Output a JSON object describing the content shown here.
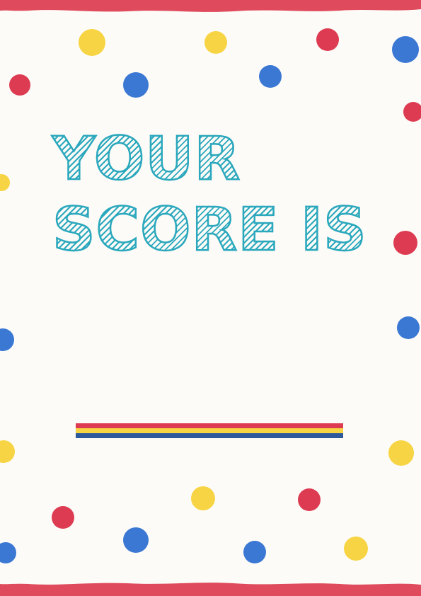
{
  "heading": {
    "line1": "YOUR",
    "line2": "SCORE IS"
  },
  "colors": {
    "background": "#fdfbf7",
    "border": "#df4a5c",
    "title": "#2ba8bd",
    "red": "#dd3b52",
    "yellow": "#f7d443",
    "blue": "#3a78d4",
    "stripe_blue": "#2e5a9c"
  }
}
